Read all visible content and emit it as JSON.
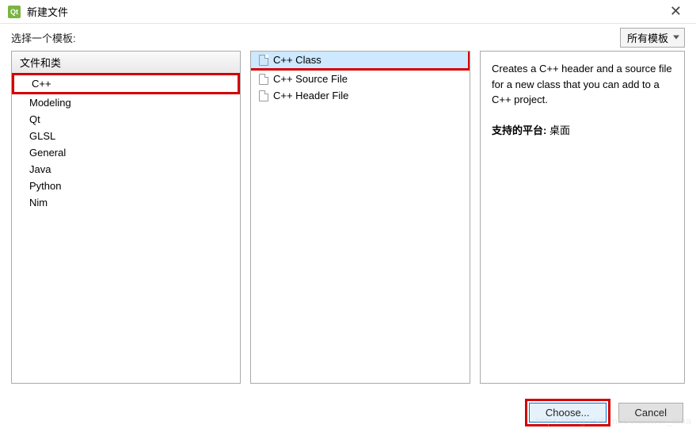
{
  "window": {
    "title": "新建文件"
  },
  "prompt": "选择一个模板:",
  "filter": {
    "label": "所有模板"
  },
  "categories": {
    "header": "文件和类",
    "items": [
      {
        "label": "C++",
        "selected": true
      },
      {
        "label": "Modeling"
      },
      {
        "label": "Qt"
      },
      {
        "label": "GLSL"
      },
      {
        "label": "General"
      },
      {
        "label": "Java"
      },
      {
        "label": "Python"
      },
      {
        "label": "Nim"
      }
    ]
  },
  "templates": {
    "items": [
      {
        "label": "C++ Class",
        "selected": true
      },
      {
        "label": "C++ Source File"
      },
      {
        "label": "C++ Header File"
      }
    ]
  },
  "description": {
    "text": "Creates a C++ header and a source file for a new class that you can add to a C++ project.",
    "platform_label": "支持的平台:",
    "platform_value": "桌面"
  },
  "buttons": {
    "choose": "Choose...",
    "cancel": "Cancel"
  },
  "watermark": "https://blog.csdn.net/Viciower_mba"
}
